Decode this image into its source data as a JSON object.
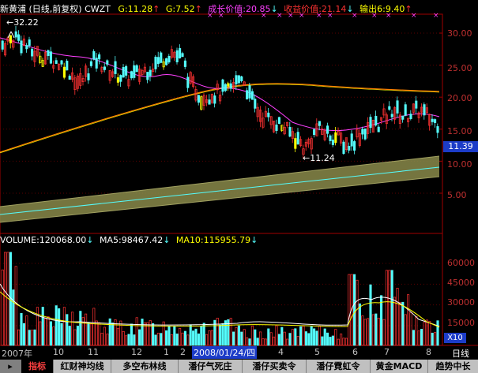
{
  "header": {
    "title": "新黄浦 (日线,前复权) CWZT",
    "g1": "G:11.28",
    "g2": "G:7.52",
    "growth_value": "成长价值:20.85",
    "earning_value": "收益价值:21.14",
    "output": "输出6:9.40"
  },
  "price_chart": {
    "high_label": "32.22",
    "low_label": "11.24",
    "current_price": "11.39",
    "y_ticks": [
      "30.00",
      "25.00",
      "20.00",
      "15.00",
      "10.00",
      "5.00"
    ]
  },
  "volume_chart": {
    "title": "VOLUME:120068.00",
    "ma5": "MA5:98467.42",
    "ma10": "MA10:115955.79",
    "y_ticks": [
      "60000",
      "45000",
      "30000",
      "15000"
    ],
    "unit": "X10"
  },
  "date_axis": {
    "labels": [
      "2007年",
      "10",
      "11",
      "12",
      "1",
      "2",
      "2008/01/24/四",
      "4",
      "5",
      "6",
      "7",
      "8"
    ],
    "period": "日线"
  },
  "tabs": [
    "指标",
    "红财神均线",
    "多空布林线",
    "潘仔气死庄",
    "潘仔买卖令",
    "潘仔霓虹令",
    "黄金MACD",
    "趋势中长"
  ],
  "colors": {
    "up": "#ff3232",
    "down": "#54fcfc",
    "ma_magenta": "#ff40ff",
    "ma_orange": "#ff8000",
    "band": "#8a8a4a"
  }
}
